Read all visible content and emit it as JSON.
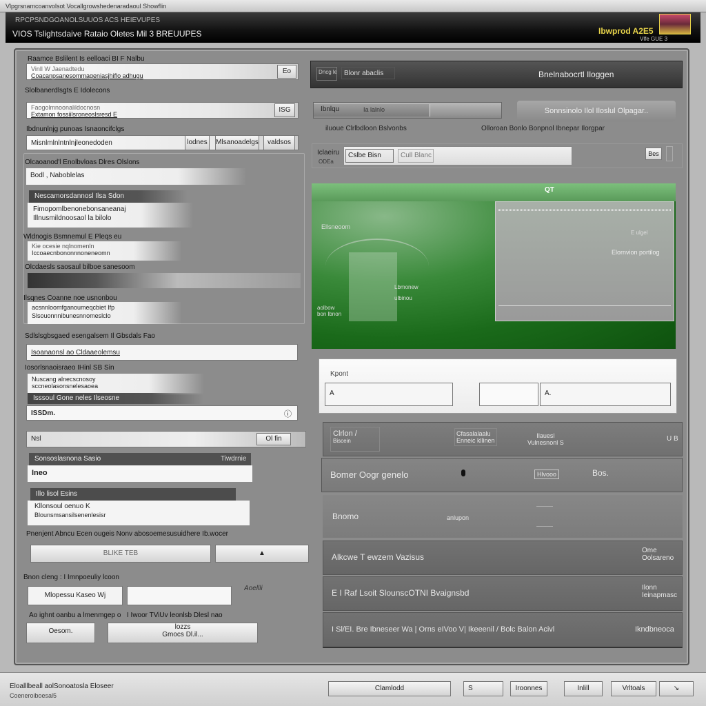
{
  "window": {
    "title": "Vlpgrsnamcoanvolsot Vocallgrowshedenaradaoul Showflin"
  },
  "header": {
    "subtitle": "RPCPSNDGOANOLSUUOS ACS HEIEVUPES",
    "title": "VIOS Tslightsdaive Rataio Oletes Mil  3 BREUUPES",
    "logo_text": "Ibwprod A2E5",
    "logo_sub": "Vlfe GUE 3",
    "accent": "#e8d44a"
  },
  "left": {
    "section1_label": "Raamce Bslilent Is eelloaci BI F Nalbu",
    "field1_line1": "Vinll W Jaenadtedu",
    "field1_line2": "Coacanpsanesommageniasjhiflo adhugu",
    "field1_btn": "Eo",
    "section2_label": "Slolbanerdlsgts E Idolecons",
    "field2_line1": "Faogolmnoonalildocnosn",
    "field2_line2": "Extamon fossiilsroneoslsresd E",
    "field2_btn": "ISG",
    "section3_label": "Ibdnunlnjg punoas Isnaoncifclgs",
    "field3_value": "Misnlmlnlntnlnjleonedoden",
    "btn_a": "lodnes",
    "btn_b": "Mlsanoadelgs",
    "btn_c": "valdsos",
    "group1_label": "Olcaoanod'l Enolbvloas Dlres Olslons",
    "group1_field": "Bodl , Naboblelas",
    "list1_header": "Nescamorsdannosl Ilsa Sdon",
    "list1_items": [
      "Fimopomlbenonebonsaneanaj",
      "Illnusmildnoosaol la bilolo"
    ],
    "group2_label": "Wldnogis Bsmnemul E Pleqs eu",
    "group2_line1": "Kie ocesie nqlnomenln",
    "group2_line2": "Iccoaecnbononnnoneneomn",
    "group3_label": "Olcdaesls saosaul bilboe sanesoom",
    "group4_label": "Ilsqnes Coanne noe usnonbou",
    "group4_line1": "acsnnloomfganoumeqcbiet Ifp",
    "group4_line2": "Slsouonnnibunesnnomeslclo",
    "section4_label": "Sdlslsgbsgaed esengalsem Il Gbsdals Fao",
    "field4_value": "Isoanaonsl ao Cldaaeolemsu",
    "section5_label": "Iosorlsnaoisraeo IHinl SB Sin",
    "s5_line1": "Nuscang alnecscnosoy",
    "s5_line2": "sccneolasonsnelesaoea",
    "s5_dark": "Isssoul Gone neles Ilseosne",
    "s5_value": "ISSDm.",
    "s5_icon": "info-icon",
    "bar_label": "Nsl",
    "bar_btn": "Ol  fin",
    "list2_header": "Sonsoslasnona Sasio",
    "list2_badge": "Tiwdrnie",
    "list2_value": "Ineo",
    "list3_header": "Illo lisol Esins",
    "list3_items": [
      "Kllonsoul oenuo K",
      "Blounsmsansilsenenlesisr"
    ],
    "desc_label": "Pnenjent Abncu Ecen ougeis Nonv abosoemesusuidhere Ib.wocer",
    "wide_btn": "BLIKE TEB",
    "dd_label": "Bnon cleng : I Imnpoeuliy lcoon",
    "dd_aside": "Aoellli",
    "dd_value": "Mlopessu Kaseo",
    "dd_value2": "Wj",
    "last_label": "Ao ighnt oanbu a lmenmgep o",
    "last_label2": "I Iwoor TViUv leonlsb Dlesl nao",
    "last_left": "Oesom.",
    "last_center_1": "lozzs",
    "last_center_2": "Gmocs  Dl.il..."
  },
  "right": {
    "top_badge": "Dncg leoqs",
    "top_tab": "Blonr abaclis",
    "top_title": "Bnelnabocrtl Iloggen",
    "progress_label": "Ibnlqu",
    "progress_text": "Ia lalnlo",
    "progress_value": 0.62,
    "progress_caption": "iluoue Clrlbdloon Bslvonbs",
    "action_btn": "Sonnsinolo  Ilol  Iloslul Olpagar..",
    "action_caption": "Olloroan Bonlo Bonpnol Ibnepar Ilorgpar",
    "search_prefix": "Iclaeiru",
    "search_prefix2": "ODEa",
    "search_tab": "Cslbe Bisn",
    "search_tab2": "Cull Blanc",
    "search_icon_label": "Bes",
    "preview_label": "Ellsneoom",
    "preview_tag": "QT",
    "preview_caption1": "Lbmonew",
    "preview_caption2": "ulbinou",
    "preview_side": "aolbow bon lbnon",
    "dialog_right1": "E ulgel",
    "dialog_right2": "Elornvion portilog",
    "input_label": "Kpont",
    "input1_value": "A",
    "input2_value": "A.",
    "rows": [
      {
        "title": "Clrlon /",
        "sub": "Biscein",
        "mid1": "Cfasalalaalu",
        "mid2": "Enneic kllinen",
        "right1": "Ilauesl",
        "right2": "Vulnesnonl S",
        "end": "U B"
      },
      {
        "title": "Bomer Oogr genelo",
        "mid": "",
        "chip": "Hlvooo",
        "end": "Bos."
      },
      {
        "title": "Bnomo",
        "mid": "anlupon",
        "end": ""
      },
      {
        "title": "Alkcwe T ewzem Vazisus",
        "end1": "Ome",
        "end2": "Oolsareno"
      },
      {
        "title": "E I Raf Lsoit SlounscOTNI Bvaignsbd",
        "end1": "Ilonn",
        "end2": "Ieinapmasc"
      },
      {
        "title": "I Sl/EI. Bre Ibneseer Wa | Orns eIVoo V| Ikeeenil / Bolc Balon Acivl",
        "end1": "Ikndbneoca"
      }
    ]
  },
  "footer": {
    "line1": "Eloalllbeall aolSonoatosla  Eloseer",
    "line2": "Coeneroiboesal5",
    "btn_combo": "Clamlodd",
    "btn_combo2": "S",
    "btn_1": "Iroonnes",
    "btn_2": "Inlill",
    "btn_3": "Vrltoals"
  }
}
